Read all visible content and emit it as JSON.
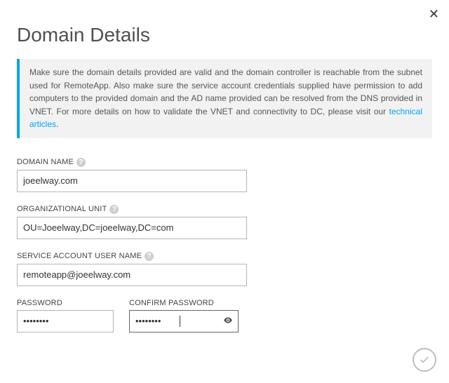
{
  "close_glyph": "✕",
  "title": "Domain Details",
  "info": {
    "text_before_link": "Make sure the domain details provided are valid and the domain controller is reachable from the subnet used for RemoteApp. Also make sure the service account credentials supplied have permission to add computers to the provided domain and the AD name provided can be resolved from the DNS provided in VNET. For more details on how to validate the VNET and connectivity to DC, please visit our ",
    "link_text": "technical articles",
    "text_after_link": "."
  },
  "form": {
    "domain_name": {
      "label": "DOMAIN NAME",
      "value": "joeelway.com"
    },
    "ou": {
      "label": "ORGANIZATIONAL UNIT",
      "value": "OU=Joeelway,DC=joeelway,DC=com"
    },
    "service_account": {
      "label": "SERVICE ACCOUNT USER NAME",
      "value": "remoteapp@joeelway.com"
    },
    "password": {
      "label": "PASSWORD",
      "value": "••••••••"
    },
    "confirm_password": {
      "label": "CONFIRM PASSWORD",
      "value": "••••••••"
    }
  },
  "help_glyph": "?",
  "colors": {
    "accent": "#00a4ef",
    "info_bg": "#f2f2f2"
  }
}
